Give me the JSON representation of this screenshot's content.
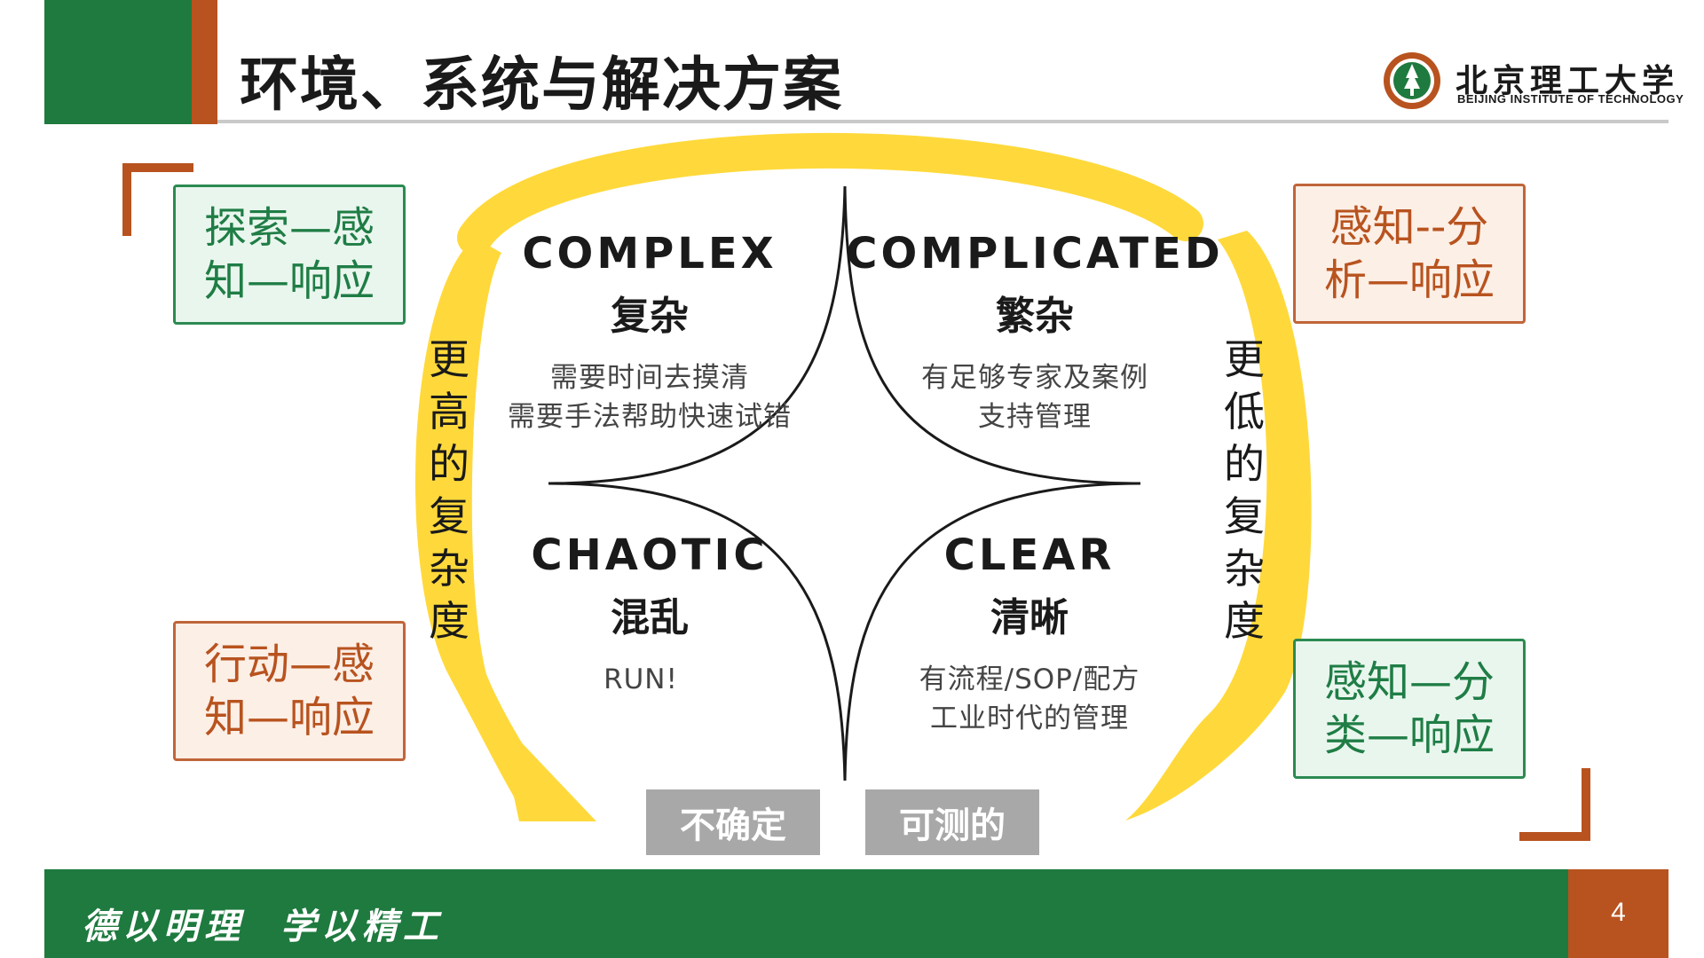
{
  "header": {
    "title": "环境、系统与解决方案",
    "logo_name": "北京理工大学",
    "logo_sub": "BEIJING INSTITUTE OF TECHNOLOGY"
  },
  "side_boxes": {
    "top_left": "探索—感\n知—响应",
    "bottom_left": "行动—感\n知—响应",
    "top_right": "感知--分\n析—响应",
    "bottom_right": "感知—分\n类—响应"
  },
  "vertical_labels": {
    "left": "更高的复杂度",
    "right": "更低的复杂度"
  },
  "quadrants": {
    "complex": {
      "en": "COMPLEX",
      "cn": "复杂",
      "desc": "需要时间去摸清\n需要手法帮助快速试错"
    },
    "complicated": {
      "en": "COMPLICATED",
      "cn": "繁杂",
      "desc": "有足够专家及案例\n支持管理"
    },
    "chaotic": {
      "en": "CHAOTIC",
      "cn": "混乱",
      "desc": "RUN!"
    },
    "clear": {
      "en": "CLEAR",
      "cn": "清晰",
      "desc": "有流程/SOP/配方\n工业时代的管理"
    }
  },
  "tags": {
    "uncertain": "不确定",
    "measurable": "可测的"
  },
  "footer": {
    "motto": "德以明理  学以精工",
    "page_number": "4"
  },
  "colors": {
    "brand_green": "#1e7a3e",
    "brand_orange": "#b8531f",
    "arrow_yellow": "#ffd93b",
    "tag_gray": "#a8a8a8"
  }
}
